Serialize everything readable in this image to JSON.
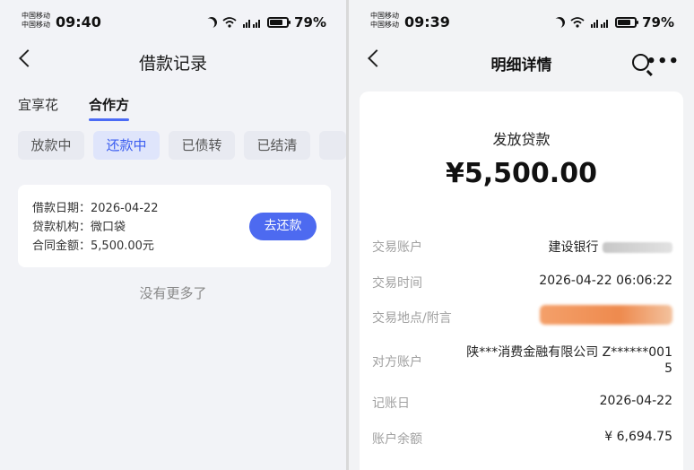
{
  "left": {
    "status": {
      "carrier1": "中国移动",
      "carrier2": "中国移动",
      "time": "09:40",
      "battery": "79%",
      "battery_level": 0.79
    },
    "title": "借款记录",
    "top_tabs": [
      "宜享花",
      "合作方"
    ],
    "filter_pills": [
      "放款中",
      "还款中",
      "已债转",
      "已结清"
    ],
    "loan": {
      "date_label": "借款日期：",
      "date": "2026-04-22",
      "org_label": "贷款机构：",
      "org": "微口袋",
      "amount_label": "合同金额：",
      "amount": "5,500.00元",
      "repay_button": "去还款"
    },
    "no_more": "没有更多了"
  },
  "right": {
    "status": {
      "carrier1": "中国移动",
      "carrier2": "中国移动",
      "time": "09:39",
      "battery": "79%",
      "battery_level": 0.79
    },
    "title": "明细详情",
    "detail_title": "发放贷款",
    "amount": "¥5,500.00",
    "rows": {
      "account_label": "交易账户",
      "account_value": "建设银行",
      "time_label": "交易时间",
      "time_value": "2026-04-22 06:06:22",
      "place_label": "交易地点/附言",
      "counter_label": "对方账户",
      "counter_value_1": "陕***消费金融有限公司 Z******001",
      "counter_value_2": "5",
      "post_label": "记账日",
      "post_value": "2026-04-22",
      "balance_label": "账户余额",
      "balance_value": "¥ 6,694.75"
    }
  }
}
